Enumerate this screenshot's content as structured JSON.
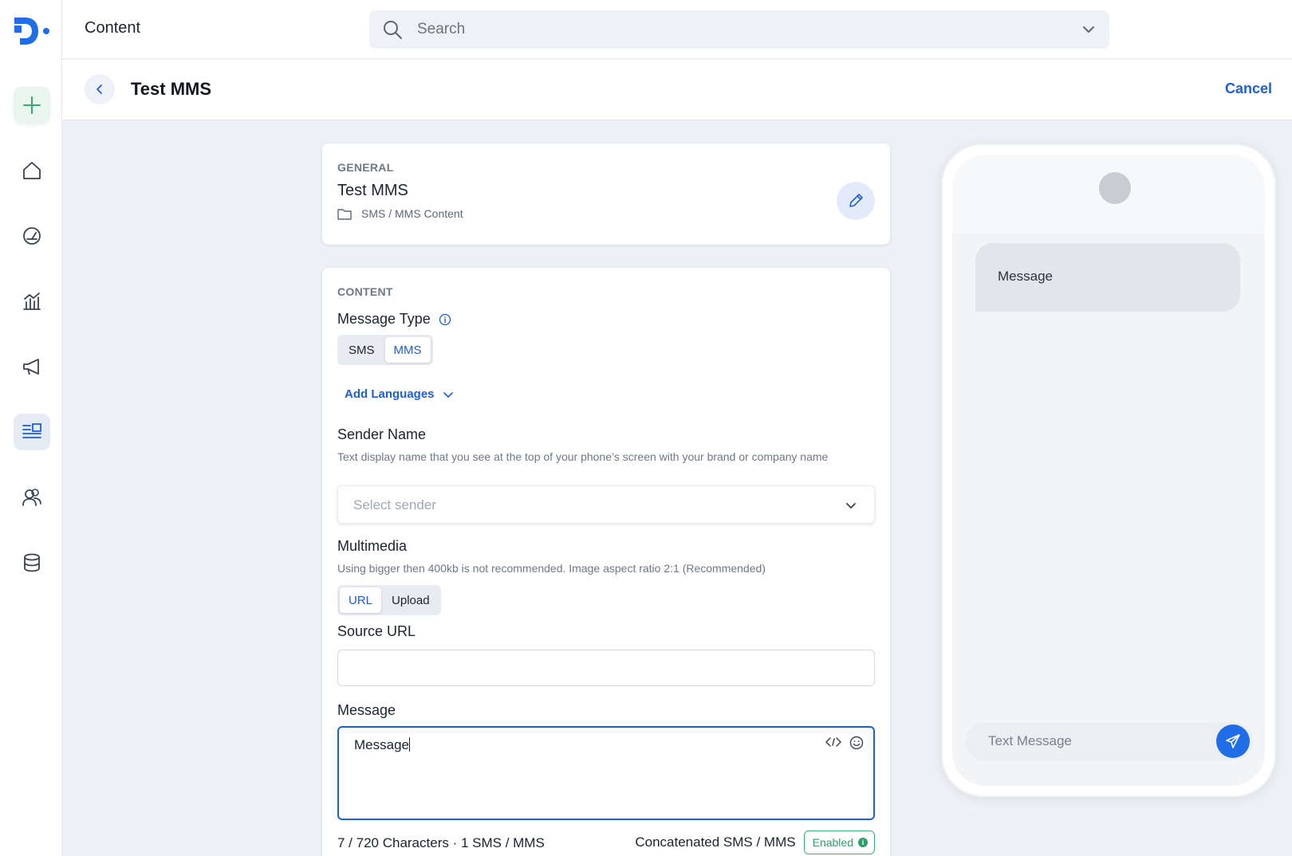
{
  "app": {
    "title": "Content"
  },
  "search": {
    "placeholder": "Search"
  },
  "page": {
    "title": "Test MMS",
    "cancel_label": "Cancel"
  },
  "general": {
    "section_label": "GENERAL",
    "name": "Test MMS",
    "folder": "SMS / MMS Content"
  },
  "content": {
    "section_label": "CONTENT",
    "message_type": {
      "label": "Message Type",
      "options": [
        "SMS",
        "MMS"
      ],
      "selected": "MMS"
    },
    "add_languages_label": "Add Languages",
    "sender": {
      "label": "Sender Name",
      "help": "Text display name that you see at the top of your phone’s screen with your brand or company name",
      "placeholder": "Select sender"
    },
    "multimedia": {
      "label": "Multimedia",
      "help": "Using bigger then 400kb is not recommended. Image aspect ratio 2:1 (Recommended)",
      "options": [
        "URL",
        "Upload"
      ],
      "selected": "URL"
    },
    "source_url": {
      "label": "Source URL",
      "value": ""
    },
    "message": {
      "label": "Message",
      "value": "Message",
      "counts": "7 / 720 Characters · 1 SMS / MMS",
      "concatenated_label": "Concatenated SMS / MMS",
      "concatenated_status": "Enabled"
    }
  },
  "preview": {
    "bubble_text": "Message",
    "compose_placeholder": "Text Message"
  },
  "colors": {
    "accent": "#1f5fd6",
    "success": "#2f9e6a",
    "background": "#edf0f4"
  },
  "icons": {
    "sidebar": [
      "plus-icon",
      "home-icon",
      "dashboard-gauge-icon",
      "analytics-icon",
      "megaphone-icon",
      "content-icon",
      "audience-icon",
      "database-icon"
    ]
  }
}
